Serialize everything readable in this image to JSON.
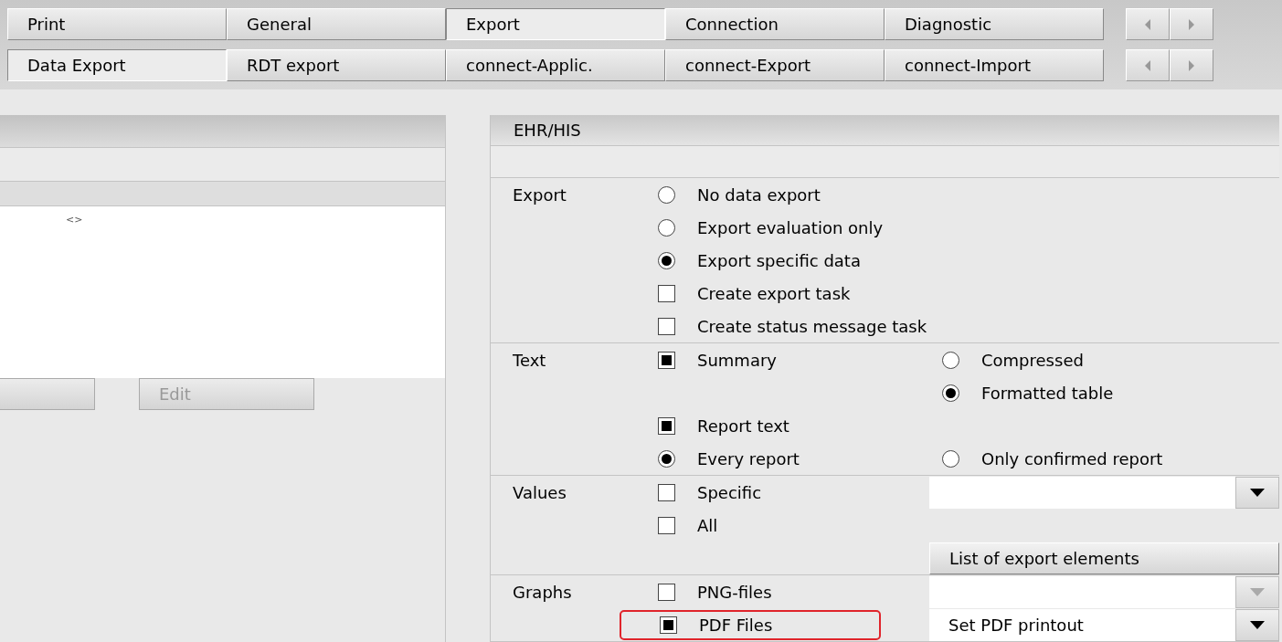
{
  "tab_rows": [
    {
      "tabs": [
        {
          "label": "Print",
          "selected": false
        },
        {
          "label": "General",
          "selected": false
        },
        {
          "label": "Export",
          "selected": true
        },
        {
          "label": "Connection",
          "selected": false
        },
        {
          "label": "Diagnostic",
          "selected": false
        }
      ]
    },
    {
      "tabs": [
        {
          "label": "Data Export",
          "selected": true
        },
        {
          "label": "RDT export",
          "selected": false
        },
        {
          "label": "connect-Applic.",
          "selected": false
        },
        {
          "label": "connect-Export",
          "selected": false
        },
        {
          "label": "connect-Import",
          "selected": false
        }
      ]
    }
  ],
  "left_panel": {
    "list_text": "<>",
    "edit_button": {
      "label": "Edit",
      "disabled": true
    }
  },
  "right_panel": {
    "title": "EHR/HIS",
    "sections": [
      {
        "label": "Export",
        "rows": [
          {
            "left": {
              "kind": "radio",
              "label": "No data export",
              "checked": false
            }
          },
          {
            "left": {
              "kind": "radio",
              "label": "Export evaluation only",
              "checked": false
            }
          },
          {
            "left": {
              "kind": "radio",
              "label": "Export specific data",
              "checked": true
            }
          },
          {
            "left": {
              "kind": "checkbox",
              "label": "Create export task",
              "checked": false
            }
          },
          {
            "left": {
              "kind": "checkbox",
              "label": "Create status message task",
              "checked": false
            }
          }
        ]
      },
      {
        "label": "Text",
        "rows": [
          {
            "left": {
              "kind": "checkbox",
              "label": "Summary",
              "checked": true
            },
            "right": {
              "kind": "radio",
              "label": "Compressed",
              "checked": false
            }
          },
          {
            "right": {
              "kind": "radio",
              "label": "Formatted table",
              "checked": true
            }
          },
          {
            "left": {
              "kind": "checkbox",
              "label": "Report text",
              "checked": true
            }
          },
          {
            "left": {
              "kind": "radio",
              "label": "Every report",
              "checked": true
            },
            "right": {
              "kind": "radio",
              "label": "Only confirmed report",
              "checked": false
            }
          }
        ]
      },
      {
        "label": "Values",
        "rows": [
          {
            "left": {
              "kind": "checkbox",
              "label": "Specific",
              "checked": false
            },
            "right": {
              "kind": "dropdown",
              "disabled": false
            }
          },
          {
            "left": {
              "kind": "checkbox",
              "label": "All",
              "checked": false
            }
          },
          {
            "right": {
              "kind": "button",
              "label": "List of export elements"
            }
          }
        ]
      },
      {
        "label": "Graphs",
        "rows": [
          {
            "left": {
              "kind": "checkbox",
              "label": "PNG-files",
              "checked": false,
              "highlighted": false
            },
            "right": {
              "kind": "dropdown",
              "disabled": true
            }
          },
          {
            "left": {
              "kind": "checkbox",
              "label": "PDF Files",
              "checked": true,
              "highlighted": true
            },
            "right": {
              "kind": "dropdown",
              "value": "Set PDF printout",
              "disabled": false
            }
          }
        ]
      }
    ]
  }
}
